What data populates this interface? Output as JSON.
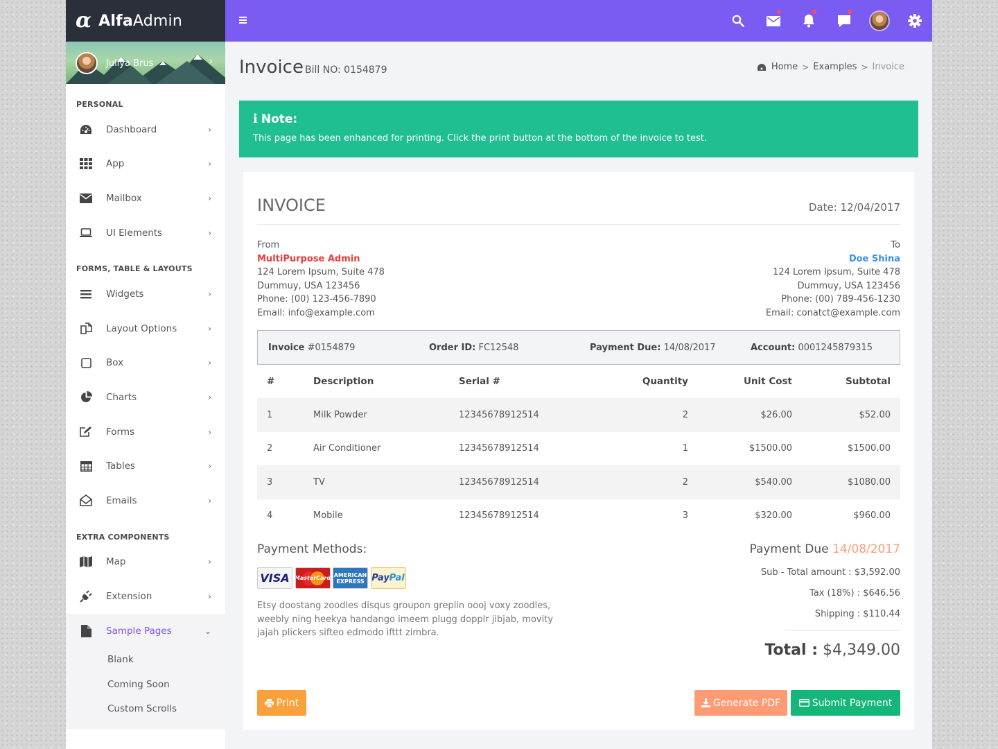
{
  "app": {
    "logo_mark": "α",
    "logo_bold": "Alfa",
    "logo_light": "Admin"
  },
  "user": {
    "name": "Juliya Brus",
    "arrow": "›"
  },
  "sidebar": {
    "sections": [
      {
        "title": "PERSONAL"
      },
      {
        "title": "FORMS, TABLE & LAYOUTS"
      },
      {
        "title": "EXTRA COMPONENTS"
      }
    ],
    "items": [
      {
        "label": "Dashboard",
        "icon": "dashboard-icon"
      },
      {
        "label": "App",
        "icon": "grid-icon"
      },
      {
        "label": "Mailbox",
        "icon": "envelope-icon"
      },
      {
        "label": "UI Elements",
        "icon": "laptop-icon"
      },
      {
        "label": "Widgets",
        "icon": "bars-icon"
      },
      {
        "label": "Layout Options",
        "icon": "copy-icon"
      },
      {
        "label": "Box",
        "icon": "square-icon"
      },
      {
        "label": "Charts",
        "icon": "pie-chart-icon"
      },
      {
        "label": "Forms",
        "icon": "edit-icon"
      },
      {
        "label": "Tables",
        "icon": "table-icon"
      },
      {
        "label": "Emails",
        "icon": "envelope-open-icon"
      },
      {
        "label": "Map",
        "icon": "map-icon"
      },
      {
        "label": "Extension",
        "icon": "plug-icon"
      },
      {
        "label": "Sample Pages",
        "icon": "file-icon"
      }
    ],
    "subitems": [
      "Blank",
      "Coming Soon",
      "Custom Scrolls"
    ],
    "arrow": "›",
    "arrow_down": "⌄"
  },
  "colors": {
    "accent": "#7b5cf2",
    "note_bg": "#1fbf91",
    "print": "#fba13b",
    "pdf": "#fe9b74",
    "submit": "#14b67a"
  },
  "header": {
    "title": "Invoice",
    "subtitle": "Bill NO: 0154879",
    "breadcrumb": {
      "home": "Home",
      "examples": "Examples",
      "current": "Invoice",
      "sep": ">"
    }
  },
  "note": {
    "title": "Note:",
    "icon": "info-icon",
    "text": "This page has been enhanced for printing. Click the print button at the bottom of the invoice to test."
  },
  "invoice": {
    "title": "INVOICE",
    "date": "Date: 12/04/2017",
    "from": {
      "label": "From",
      "name": "MultiPurpose Admin",
      "address1": "124 Lorem Ipsum, Suite 478",
      "address2": "Dummuy, USA 123456",
      "phone": "Phone: (00) 123-456-7890",
      "email": "Email: info@example.com"
    },
    "to": {
      "label": "To",
      "name": "Doe Shina",
      "address1": "124 Lorem Ipsum, Suite 478",
      "address2": "Dummuy, USA 123456",
      "phone": "Phone: (00) 789-456-1230",
      "email": "Email: conatct@example.com"
    },
    "meta": {
      "invoice_label": "Invoice",
      "invoice_value": "#0154879",
      "order_label": "Order ID:",
      "order_value": "FC12548",
      "due_label": "Payment Due:",
      "due_value": "14/08/2017",
      "account_label": "Account:",
      "account_value": "0001245879315"
    },
    "columns": [
      "#",
      "Description",
      "Serial #",
      "Quantity",
      "Unit Cost",
      "Subtotal"
    ],
    "rows": [
      [
        "1",
        "Milk Powder",
        "12345678912514",
        "2",
        "$26.00",
        "$52.00"
      ],
      [
        "2",
        "Air Conditioner",
        "12345678912514",
        "1",
        "$1500.00",
        "$1500.00"
      ],
      [
        "3",
        "TV",
        "12345678912514",
        "2",
        "$540.00",
        "$1080.00"
      ],
      [
        "4",
        "Mobile",
        "12345678912514",
        "3",
        "$320.00",
        "$960.00"
      ]
    ],
    "payment_methods": {
      "title": "Payment Methods:",
      "cards": {
        "visa": "VISA",
        "mastercard": "MasterCard",
        "amex1": "AMERICAN",
        "amex2": "EXPRESS",
        "paypal1": "Pay",
        "paypal2": "Pal"
      },
      "text": "Etsy doostang zoodles disqus groupon greplin oooj voxy zoodles, weebly ning heekya handango imeem plugg dopplr jibjab, movity jajah plickers sifteo edmodo ifttt zimbra."
    },
    "totals": {
      "due_label": "Payment Due",
      "due_date": "14/08/2017",
      "subtotal": "Sub - Total amount : $3,592.00",
      "tax": "Tax (18%) : $646.56",
      "shipping": "Shipping : $110.44",
      "total_label": "Total :",
      "total_value": "$4,349.00"
    }
  },
  "actions": {
    "print": "Print",
    "pdf": "Generate PDF",
    "submit": "Submit Payment"
  }
}
